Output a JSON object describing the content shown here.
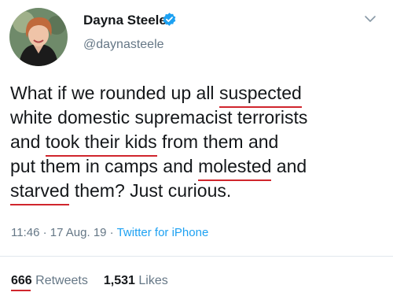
{
  "author": {
    "name": "Dayna Steele",
    "handle": "@daynasteele",
    "avatar": "profile-photo",
    "verified_icon": "verified-badge-icon"
  },
  "tweet": {
    "lines": [
      [
        "What if we rounded up all ",
        "suspected",
        ""
      ],
      [
        "white domestic supremacist terrorists",
        "",
        ""
      ],
      [
        "and ",
        "took their kids",
        " from them and"
      ],
      [
        "put them in camps and ",
        "molested",
        " and"
      ],
      [
        "",
        "starved",
        " them? Just curious."
      ]
    ]
  },
  "meta": {
    "time": "11:46",
    "sep1": " · ",
    "date": "17 Aug. 19",
    "sep2": " · ",
    "source": "Twitter for iPhone"
  },
  "stats": {
    "retweets_count": "666",
    "retweets_label": "Retweets",
    "likes_count": "1,531",
    "likes_label": "Likes"
  },
  "colors": {
    "text": "#14171a",
    "muted": "#657786",
    "link": "#1da1f2",
    "underline": "#d0262d"
  }
}
